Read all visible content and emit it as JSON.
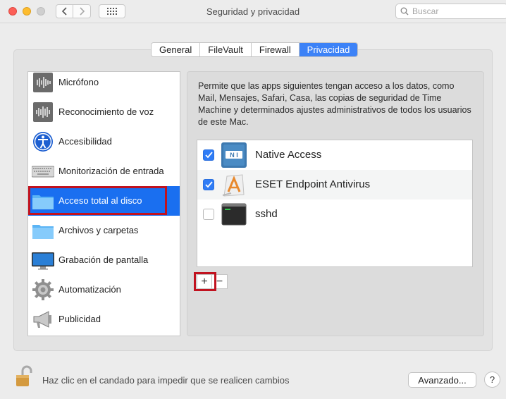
{
  "window": {
    "title": "Seguridad y privacidad",
    "search_placeholder": "Buscar"
  },
  "tabs": [
    {
      "label": "General",
      "active": false
    },
    {
      "label": "FileVault",
      "active": false
    },
    {
      "label": "Firewall",
      "active": false
    },
    {
      "label": "Privacidad",
      "active": true
    }
  ],
  "sidebar": {
    "items": [
      {
        "label": "Micrófono",
        "icon": "microphone-icon"
      },
      {
        "label": "Reconocimiento de voz",
        "icon": "speech-recognition-icon"
      },
      {
        "label": "Accesibilidad",
        "icon": "accessibility-icon"
      },
      {
        "label": "Monitorización de entrada",
        "icon": "keyboard-icon"
      },
      {
        "label": "Acceso total al disco",
        "icon": "folder-icon",
        "selected": true
      },
      {
        "label": "Archivos y carpetas",
        "icon": "folder-icon"
      },
      {
        "label": "Grabación de pantalla",
        "icon": "display-icon"
      },
      {
        "label": "Automatización",
        "icon": "gear-icon"
      },
      {
        "label": "Publicidad",
        "icon": "megaphone-icon"
      }
    ]
  },
  "content": {
    "description": "Permite que las apps siguientes tengan acceso a los datos, como Mail, Mensajes, Safari, Casa, las copias de seguridad de Time Machine y determinados ajustes administrativos de todos los usuarios de este Mac.",
    "apps": [
      {
        "name": "Native Access",
        "checked": true,
        "icon": "native-access-icon"
      },
      {
        "name": "ESET Endpoint Antivirus",
        "checked": true,
        "icon": "app-installer-icon"
      },
      {
        "name": "sshd",
        "checked": false,
        "icon": "terminal-icon"
      }
    ],
    "add_label": "+",
    "remove_label": "−"
  },
  "footer": {
    "lock_text": "Haz clic en el candado para impedir que se realicen cambios",
    "advanced_label": "Avanzado...",
    "help_label": "?"
  },
  "colors": {
    "selection": "#1a6ff0",
    "active_tab": "#3c82f7",
    "highlight_outline": "#c1121f",
    "checkbox_on": "#2f7cf6"
  }
}
